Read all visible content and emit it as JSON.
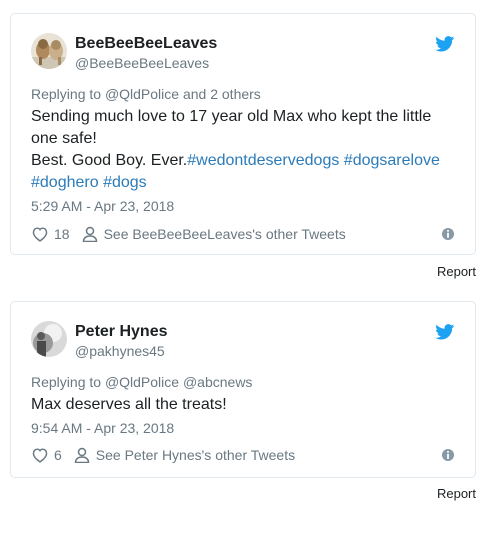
{
  "tweets": [
    {
      "display_name": "BeeBeeBeeLeaves",
      "handle": "@BeeBeeBeeLeaves",
      "reply_prefix": "Replying to ",
      "reply_to": "@QldPolice",
      "reply_suffix": " and 2 others",
      "text_line1": "Sending much love to 17 year old Max who kept the little",
      "text_line2": "one safe!",
      "text_line3_plain": "Best. Good Boy. Ever.",
      "hashtags": [
        "#wedontdeservedogs",
        "#dogsarelove",
        "#doghero",
        "#dogs"
      ],
      "timestamp": "5:29 AM - Apr 23, 2018",
      "likes": "18",
      "other_tweets_label": "See BeeBeeBeeLeaves's other Tweets",
      "report_label": "Report"
    },
    {
      "display_name": "Peter Hynes",
      "handle": "@pakhynes45",
      "reply_prefix": "Replying to ",
      "reply_to": "@QldPolice",
      "reply_to_2": "@abcnews",
      "text_line1": "Max deserves all the treats!",
      "timestamp": "9:54 AM - Apr 23, 2018",
      "likes": "6",
      "other_tweets_label": "See Peter Hynes's other Tweets",
      "report_label": "Report"
    }
  ],
  "colors": {
    "link": "#2b7bb9",
    "twitter_blue": "#1da1f2",
    "muted": "#697882",
    "text": "#1c2022",
    "border": "#e1e8ed"
  },
  "icons": [
    "twitter-bird-icon",
    "heart-icon",
    "person-icon",
    "info-icon"
  ]
}
